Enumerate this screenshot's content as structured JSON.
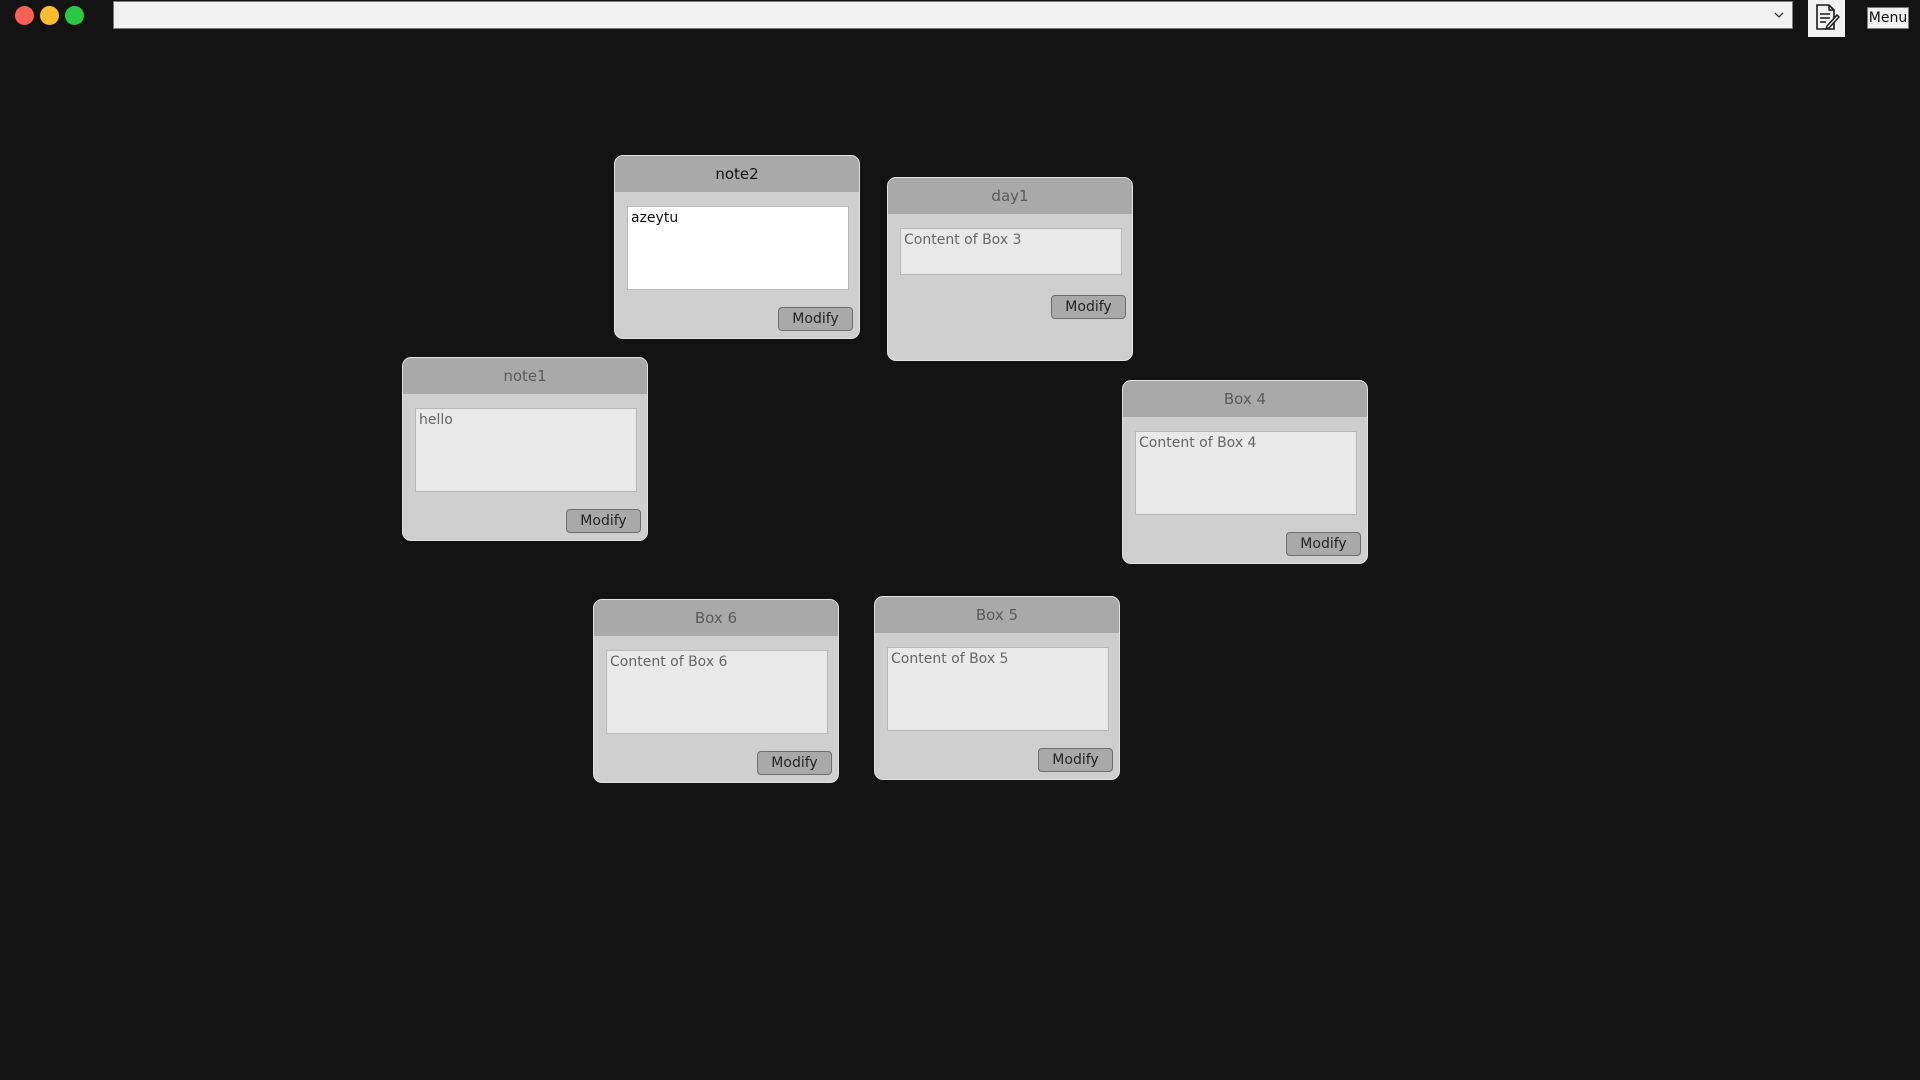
{
  "toolbar": {
    "selector_value": "",
    "selector_chevron_icon": "chevron-down-icon",
    "notes_icon": "document-edit-icon",
    "menu_label": "Menu"
  },
  "window_controls": {
    "close_color": "#fe5f57",
    "minimize_color": "#febc2e",
    "maximize_color": "#28c840"
  },
  "boxes": [
    {
      "title": "note2",
      "content": "azeytu",
      "button": "Modify"
    },
    {
      "title": "day1",
      "content": "Content of Box 3",
      "button": "Modify"
    },
    {
      "title": "note1",
      "content": "hello",
      "button": "Modify"
    },
    {
      "title": "Box 4",
      "content": "Content of Box 4",
      "button": "Modify"
    },
    {
      "title": "Box 6",
      "content": "Content of Box 6",
      "button": "Modify"
    },
    {
      "title": "Box 5",
      "content": "Content of Box 5",
      "button": "Modify"
    }
  ]
}
